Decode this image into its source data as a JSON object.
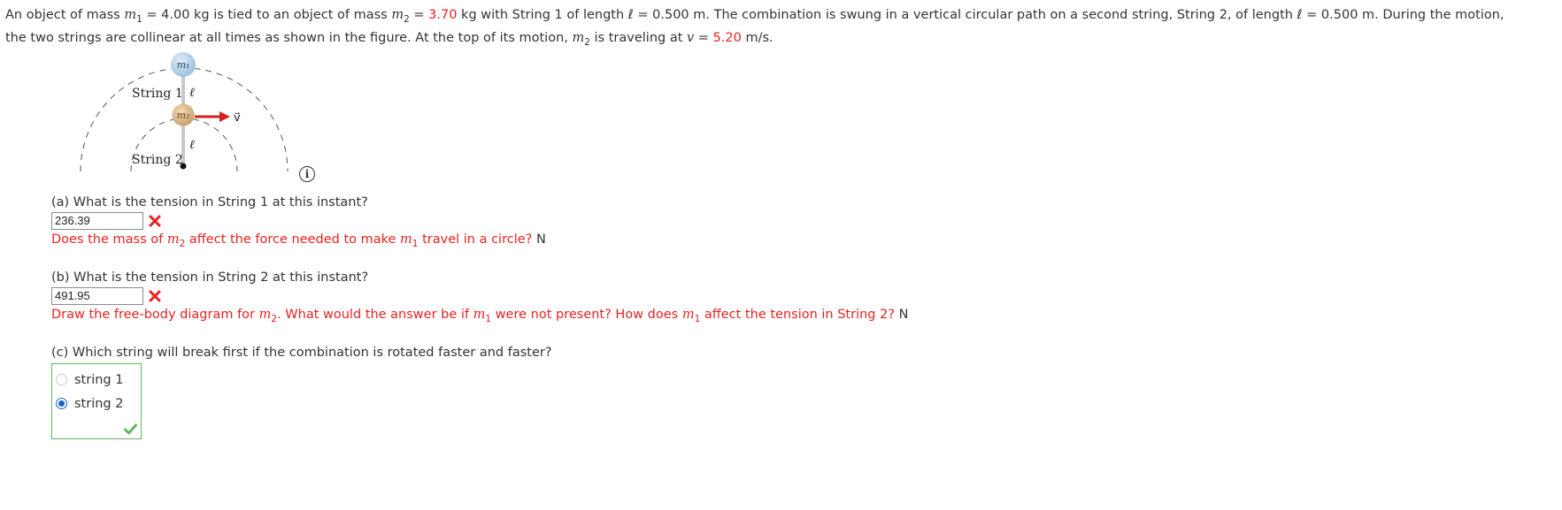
{
  "problem": {
    "line1_a": "An object of mass ",
    "m1_sym": "m",
    "m1_sub": "1",
    "line1_b": " = 4.00 kg is tied to an object of mass ",
    "m2_sym": "m",
    "m2_sub": "2",
    "line1_c": " = ",
    "m2_value": "3.70",
    "line1_d": " kg with String 1 of length ℓ = 0.500 m. The combination is swung in a vertical circular path on a second string, String 2, of length ℓ = 0.500 m. During the motion,",
    "line2_a": "the two strings are collinear at all times as shown in the figure. At the top of its motion, ",
    "m2b_sym": "m",
    "m2b_sub": "2",
    "line2_b": " is traveling at ",
    "v_sym": "v",
    "line2_c": " = ",
    "v_value": "5.20",
    "line2_d": " m/s."
  },
  "figure": {
    "m1_label": "m₁",
    "m2_label": "m₂",
    "string1_label": "String 1",
    "string2_label": "String 2",
    "ell_label": "ℓ",
    "v_label": "v⃗"
  },
  "parts": {
    "a": {
      "question": "(a) What is the tension in String 1 at this instant?",
      "answer": "236.39",
      "hint_a": "Does the mass of ",
      "hint_sym1": "m",
      "hint_sub1": "2",
      "hint_b": " affect the force needed to make ",
      "hint_sym2": "m",
      "hint_sub2": "1",
      "hint_c": " travel in a circle?",
      "hint_n": " N"
    },
    "b": {
      "question": "(b) What is the tension in String 2 at this instant?",
      "answer": "491.95",
      "hint_a": "Draw the free-body diagram for ",
      "hint_sym1": "m",
      "hint_sub1": "2",
      "hint_b": ". What would the answer be if ",
      "hint_sym2": "m",
      "hint_sub2": "1",
      "hint_c": " were not present? How does ",
      "hint_sym3": "m",
      "hint_sub3": "1",
      "hint_d": " affect the tension in String 2?",
      "hint_n": " N"
    },
    "c": {
      "question": "(c) Which string will break first if the combination is rotated faster and faster?",
      "options": [
        "string 1",
        "string 2"
      ],
      "selected": "string 2"
    }
  },
  "colors": {
    "error": "#e8211f",
    "correct": "#5cb85c",
    "radio_selected": "#1a5fcc"
  },
  "icons": {
    "info": "info-icon",
    "wrong": "x-icon",
    "correct": "check-icon"
  }
}
